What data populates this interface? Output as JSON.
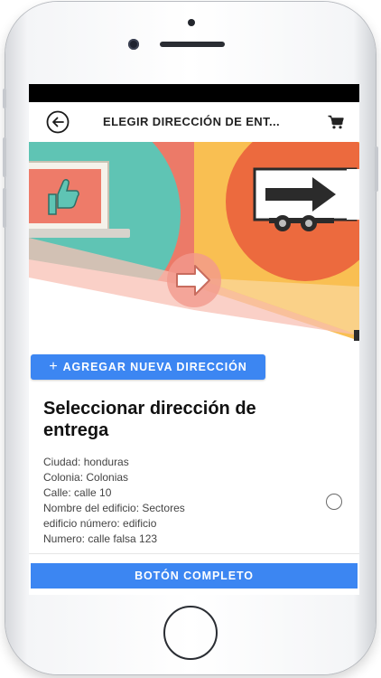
{
  "appbar": {
    "title": "ELEGIR DIRECCIÓN DE ENT..."
  },
  "actions": {
    "add_address_label": "AGREGAR NUEVA DIRECCIÓN",
    "complete_label": "BOTÓN COMPLETO"
  },
  "address_section": {
    "heading": "Seleccionar dirección de entrega",
    "lines": [
      "Ciudad: honduras",
      "Colonia: Colonias",
      "Calle: calle 10",
      "Nombre del edificio: Sectores",
      "edificio número: edificio",
      "Numero: calle falsa 123"
    ],
    "selected": false
  },
  "icons": {
    "back": "arrow-left-circle-icon",
    "cart": "shopping-cart-icon",
    "add": "plus-icon"
  },
  "colors": {
    "primary_button": "#3c86f2",
    "status_bar": "#000000",
    "banner_teal": "#5fc4b4",
    "banner_coral": "#ec7a68",
    "banner_yellow": "#f9bf52",
    "banner_orange": "#ec6a3e"
  }
}
